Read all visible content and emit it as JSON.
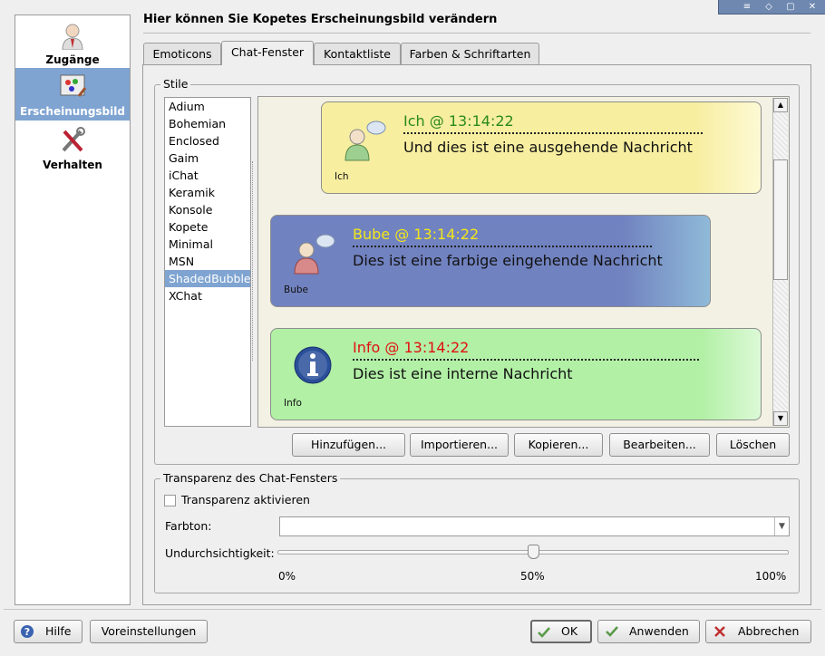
{
  "window": {
    "buttons": [
      "≡",
      "◇",
      "▢",
      "✕"
    ]
  },
  "sidebar": {
    "items": [
      {
        "label": "Zugänge",
        "icon": "user-icon",
        "selected": false
      },
      {
        "label": "Erscheinungsbild",
        "icon": "palette-icon",
        "selected": true
      },
      {
        "label": "Verhalten",
        "icon": "tools-icon",
        "selected": false
      }
    ]
  },
  "header": {
    "title": "Hier können Sie Kopetes Erscheinungsbild verändern"
  },
  "tabs": [
    "Emoticons",
    "Chat-Fenster",
    "Kontaktliste",
    "Farben & Schriftarten"
  ],
  "active_tab": "Chat-Fenster",
  "styles": {
    "legend": "Stile",
    "list": [
      "Adium",
      "Bohemian",
      "Enclosed",
      "Gaim",
      "iChat",
      "Keramik",
      "Konsole",
      "Kopete",
      "Minimal",
      "MSN",
      "ShadedBubble",
      "XChat"
    ],
    "selected": "ShadedBubble"
  },
  "preview": {
    "messages": [
      {
        "header": "Ich @ 13:14:22",
        "text": "Und dies ist eine ausgehende Nachricht",
        "nick": "Ich",
        "color": "#2a8a1a",
        "bg": "#f8f1a8"
      },
      {
        "header": "Bube @ 13:14:22",
        "text": "Dies ist eine farbige eingehende Nachricht",
        "nick": "Bube",
        "color": "#f2e61a",
        "bg": "#7182c0"
      },
      {
        "header": "Info @ 13:14:22",
        "text": "Dies ist eine interne Nachricht",
        "nick": "Info",
        "color": "#e01010",
        "bg": "#b2f0a6"
      }
    ]
  },
  "style_buttons": [
    "Hinzufügen...",
    "Importieren...",
    "Kopieren...",
    "Bearbeiten...",
    "Löschen"
  ],
  "transparency": {
    "legend": "Transparenz des Chat-Fensters",
    "enable_label": "Transparenz aktivieren",
    "enable_checked": false,
    "tint_label": "Farbton:",
    "tint_value": "",
    "opacity_label": "Undurchsichtigkeit:",
    "opacity_value_percent": 50,
    "scale": [
      "0%",
      "50%",
      "100%"
    ]
  },
  "footer": {
    "help": "Hilfe",
    "defaults": "Voreinstellungen",
    "ok": "OK",
    "apply": "Anwenden",
    "cancel": "Abbrechen"
  }
}
